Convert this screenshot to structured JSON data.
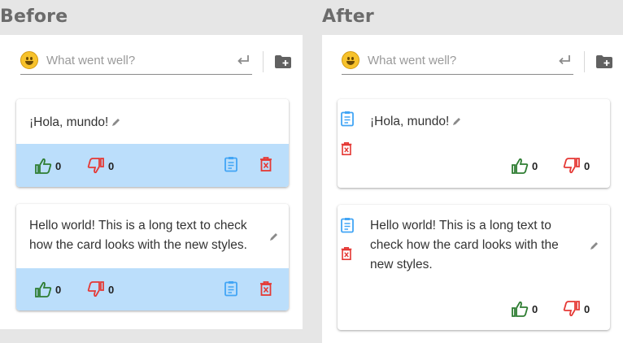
{
  "headings": {
    "before": "Before",
    "after": "After"
  },
  "input": {
    "placeholder": "What went well?"
  },
  "cards": [
    {
      "text": "¡Hola, mundo!",
      "upvotes": "0",
      "downvotes": "0"
    },
    {
      "text": "Hello world! This is a long text to check how the card looks with the new styles.",
      "upvotes": "0",
      "downvotes": "0"
    }
  ],
  "after_cards": [
    {
      "text": "¡Hola, mundo!",
      "upvotes": "0",
      "downvotes": "0"
    },
    {
      "text_lines": [
        "Hello world! This is a long text to",
        "check how the card looks with the",
        "new styles."
      ],
      "upvotes": "0",
      "downvotes": "0"
    }
  ],
  "before_card2_lines": [
    "Hello world! This is a long text to check",
    "how the card looks with the new styles."
  ],
  "colors": {
    "upvote": "#2e7d32",
    "downvote": "#e53935",
    "clipboard": "#42a5f5",
    "footer": "#bbdefb"
  },
  "icons": [
    "smile-emoji-icon",
    "enter-icon",
    "add-folder-icon",
    "pencil-icon",
    "thumb-up-icon",
    "thumb-down-icon",
    "clipboard-icon",
    "delete-icon"
  ]
}
